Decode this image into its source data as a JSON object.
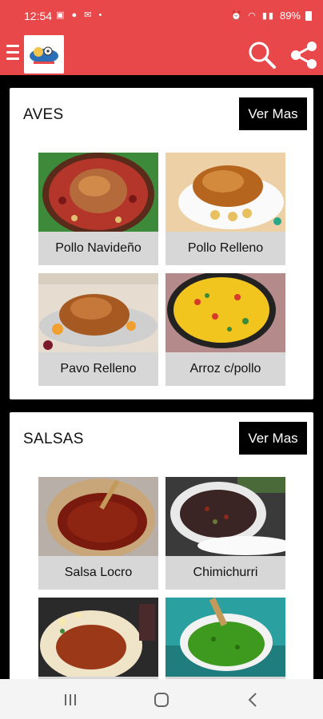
{
  "status_bar": {
    "time": "12:54",
    "left_icons": [
      "image-icon",
      "facebook-icon",
      "gmail-icon",
      "dot-icon"
    ],
    "right_icons": [
      "alarm-icon",
      "wifi-icon",
      "signal-icon"
    ],
    "battery": "89%"
  },
  "app_bar": {
    "menu_icon": "hamburger-menu-icon",
    "logo": "app-logo",
    "search_icon": "search-icon",
    "share_icon": "share-icon"
  },
  "sections": [
    {
      "title": "AVES",
      "more_label": "Ver Mas",
      "items": [
        {
          "label": "Pollo Navideño"
        },
        {
          "label": "Pollo Relleno"
        },
        {
          "label": "Pavo Relleno"
        },
        {
          "label": "Arroz c/pollo"
        }
      ]
    },
    {
      "title": "SALSAS",
      "more_label": "Ver Mas",
      "items": [
        {
          "label": "Salsa Locro"
        },
        {
          "label": "Chimichurri"
        },
        {
          "label": ""
        },
        {
          "label": ""
        }
      ]
    }
  ],
  "colors": {
    "primary": "#e9484b",
    "card_label_bg": "#d7d7d7",
    "button_bg": "#000000",
    "background": "#000000"
  }
}
